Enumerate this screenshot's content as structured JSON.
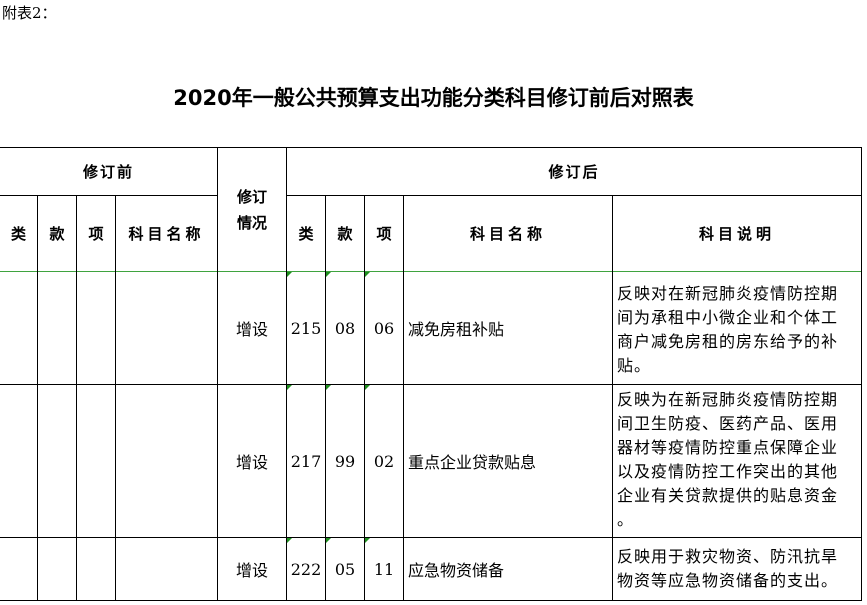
{
  "caption": "附表2：",
  "title": "2020年一般公共预算支出功能分类科目修订前后对照表",
  "header": {
    "before": "修订前",
    "status": "修订情况",
    "after": "修订后",
    "before_cols": [
      "类",
      "款",
      "项",
      "科目名称"
    ],
    "after_cols": [
      "类",
      "款",
      "项",
      "科目名称",
      "科目说明"
    ]
  },
  "rows": [
    {
      "status": "增设",
      "lei": "215",
      "kuan": "08",
      "xiang": "06",
      "name": "减免房租补贴",
      "desc_lines": [
        "反映对在新冠肺炎疫情防控期",
        "间为承租中小微企业和个体工",
        "商户减免房租的房东给予的补",
        "贴。"
      ]
    },
    {
      "status": "增设",
      "lei": "217",
      "kuan": "99",
      "xiang": "02",
      "name": "重点企业贷款贴息",
      "desc_lines": [
        "反映为在新冠肺炎疫情防控期",
        "间卫生防疫、医药产品、医用",
        "器材等疫情防控重点保障企业",
        "以及疫情防控工作突出的其他",
        "企业有关贷款提供的贴息资金",
        "。"
      ]
    },
    {
      "status": "增设",
      "lei": "222",
      "kuan": "05",
      "xiang": "11",
      "name": "应急物资储备",
      "desc_lines": [
        "反映用于救灾物资、防汛抗旱",
        "物资等应急物资储备的支出。"
      ]
    }
  ]
}
